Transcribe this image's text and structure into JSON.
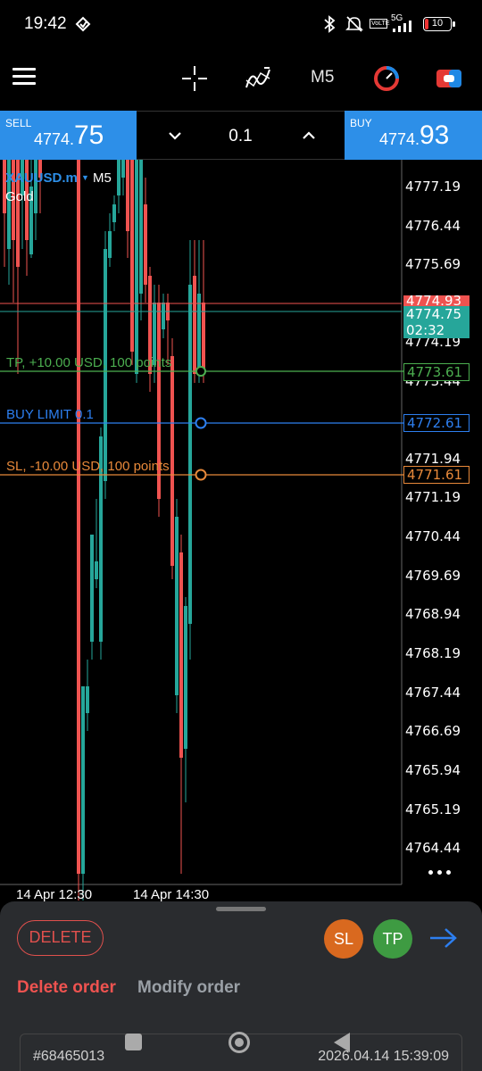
{
  "status_bar": {
    "time": "19:42",
    "network": "5G",
    "volte": "VoLTE",
    "battery": "10"
  },
  "toolbar": {
    "timeframe": "M5",
    "icons": [
      "menu-icon",
      "crosshair-icon",
      "indicator-icon",
      "timeframe-label",
      "color-scheme-icon",
      "trade-icon"
    ]
  },
  "trade": {
    "sell_label": "SELL",
    "sell_price_prefix": "4774.",
    "sell_price_big": "75",
    "buy_label": "BUY",
    "buy_price_prefix": "4774.",
    "buy_price_big": "93",
    "volume": "0.1"
  },
  "chart": {
    "symbol": "XAUUSD.m",
    "symbol_arrow": "▼",
    "timeframe": "M5",
    "name": "Gold",
    "price_axis": [
      "4777.19",
      "4776.44",
      "4775.69",
      "4774.19",
      "4773.44",
      "4771.94",
      "4771.19",
      "4770.44",
      "4769.69",
      "4768.94",
      "4768.19",
      "4767.44",
      "4766.69",
      "4765.94",
      "4765.19",
      "4764.44"
    ],
    "ask_price": "4774.93",
    "bid_price": "4774.75",
    "countdown": "02:32",
    "tp_text": "TP, +10.00 USD, 100 points",
    "tp_price": "4773.61",
    "buy_limit_text": "BUY LIMIT 0.1",
    "buy_limit_price": "4772.61",
    "sl_text": "SL, -10.00 USD, 100 points",
    "sl_price": "4771.61",
    "time_labels": [
      "14 Apr 12:30",
      "14 Apr 14:30"
    ],
    "colors": {
      "up": "#26a69a",
      "down": "#ef5350",
      "tp": "#4caf50",
      "limit": "#2d7ff0",
      "sl": "#e8893a"
    }
  },
  "sheet": {
    "delete_pill": "DELETE",
    "sl_button": "SL",
    "tp_button": "TP",
    "delete_order": "Delete order",
    "modify_order": "Modify order",
    "order_id": "#68465013",
    "order_time": "2026.04.14 15:39:09"
  }
}
